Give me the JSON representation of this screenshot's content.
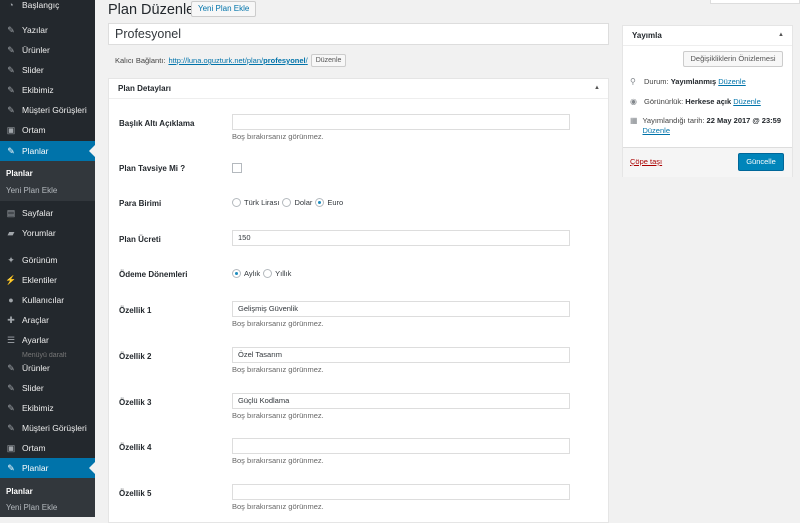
{
  "sidebar": {
    "items": [
      {
        "label": "Başlangıç",
        "icon": "dashboard-icon",
        "active": false
      },
      {
        "label": "Yazılar",
        "icon": "pin-icon",
        "active": false
      },
      {
        "label": "Ürünler",
        "icon": "pin-icon",
        "active": false
      },
      {
        "label": "Slider",
        "icon": "pin-icon",
        "active": false
      },
      {
        "label": "Ekibimiz",
        "icon": "pin-icon",
        "active": false
      },
      {
        "label": "Müşteri Görüşleri",
        "icon": "pin-icon",
        "active": false
      },
      {
        "label": "Ortam",
        "icon": "media-icon",
        "active": false
      },
      {
        "label": "Planlar",
        "icon": "pin-icon",
        "active": true
      },
      {
        "label": "Sayfalar",
        "icon": "pages-icon",
        "active": false
      },
      {
        "label": "Yorumlar",
        "icon": "comments-icon",
        "active": false
      },
      {
        "label": "Görünüm",
        "icon": "appearance-icon",
        "active": false
      },
      {
        "label": "Eklentiler",
        "icon": "plugins-icon",
        "active": false
      },
      {
        "label": "Kullanıcılar",
        "icon": "users-icon",
        "active": false
      },
      {
        "label": "Araçlar",
        "icon": "tools-icon",
        "active": false
      },
      {
        "label": "Ayarlar",
        "icon": "settings-icon",
        "active": false
      },
      {
        "label": "Ürünler",
        "icon": "pin-icon",
        "active": false
      },
      {
        "label": "Slider",
        "icon": "pin-icon",
        "active": false
      },
      {
        "label": "Ekibimiz",
        "icon": "pin-icon",
        "active": false
      },
      {
        "label": "Müşteri Görüşleri",
        "icon": "pin-icon",
        "active": false
      },
      {
        "label": "Ortam",
        "icon": "media-icon",
        "active": false
      },
      {
        "label": "Planlar",
        "icon": "pin-icon",
        "active": true
      }
    ],
    "submenu": [
      {
        "label": "Planlar",
        "current": true
      },
      {
        "label": "Yeni Plan Ekle",
        "current": false
      }
    ],
    "faded_text": "Menüyü daralt",
    "colors": {
      "background": "#23282d",
      "active": "#0073aa",
      "submenu_bg": "#32373c"
    }
  },
  "header": {
    "title": "Plan Düzenle",
    "add_new_label": "Yeni Plan Ekle"
  },
  "post": {
    "title_value": "Profesyonel",
    "permalink_label": "Kalıcı Bağlantı:",
    "permalink_base": "http://luna.oguzturk.net/plan/",
    "permalink_slug": "profesyonel",
    "permalink_trailing": "/",
    "permalink_edit_label": "Düzenle"
  },
  "details": {
    "title": "Plan Detayları",
    "help_text": "Boş bırakırsanız görünmez.",
    "fields": {
      "subtitle": {
        "label": "Başlık Altı Açıklama",
        "value": ""
      },
      "recommended": {
        "label": "Plan Tavsiye Mi ?",
        "checked": false
      },
      "currency": {
        "label": "Para Birimi",
        "options": [
          "Türk Lirası",
          "Dolar",
          "Euro"
        ],
        "selected": "Euro"
      },
      "price": {
        "label": "Plan Ücreti",
        "value": "150"
      },
      "period": {
        "label": "Ödeme Dönemleri",
        "options": [
          "Aylık",
          "Yıllık"
        ],
        "selected": "Aylık"
      },
      "feature1": {
        "label": "Özellik 1",
        "value": "Gelişmiş Güvenlik"
      },
      "feature2": {
        "label": "Özellik 2",
        "value": "Özel Tasarım"
      },
      "feature3": {
        "label": "Özellik 3",
        "value": "Güçlü Kodlama"
      },
      "feature4": {
        "label": "Özellik 4",
        "value": ""
      },
      "feature5": {
        "label": "Özellik 5",
        "value": ""
      }
    }
  },
  "publish": {
    "title": "Yayımla",
    "preview_label": "Değişikliklerin Önizlemesi",
    "status_label": "Durum:",
    "status_value": "Yayımlanmış",
    "visibility_label": "Görünürlük:",
    "visibility_value": "Herkese açık",
    "date_label": "Yayımlandığı tarih:",
    "date_value": "22 May 2017 @ 23:59",
    "edit_label": "Düzenle",
    "trash_label": "Çöpe taşı",
    "update_label": "Güncelle",
    "colors": {
      "primary": "#0085ba",
      "link": "#0073aa",
      "trash": "#aa0000"
    }
  }
}
